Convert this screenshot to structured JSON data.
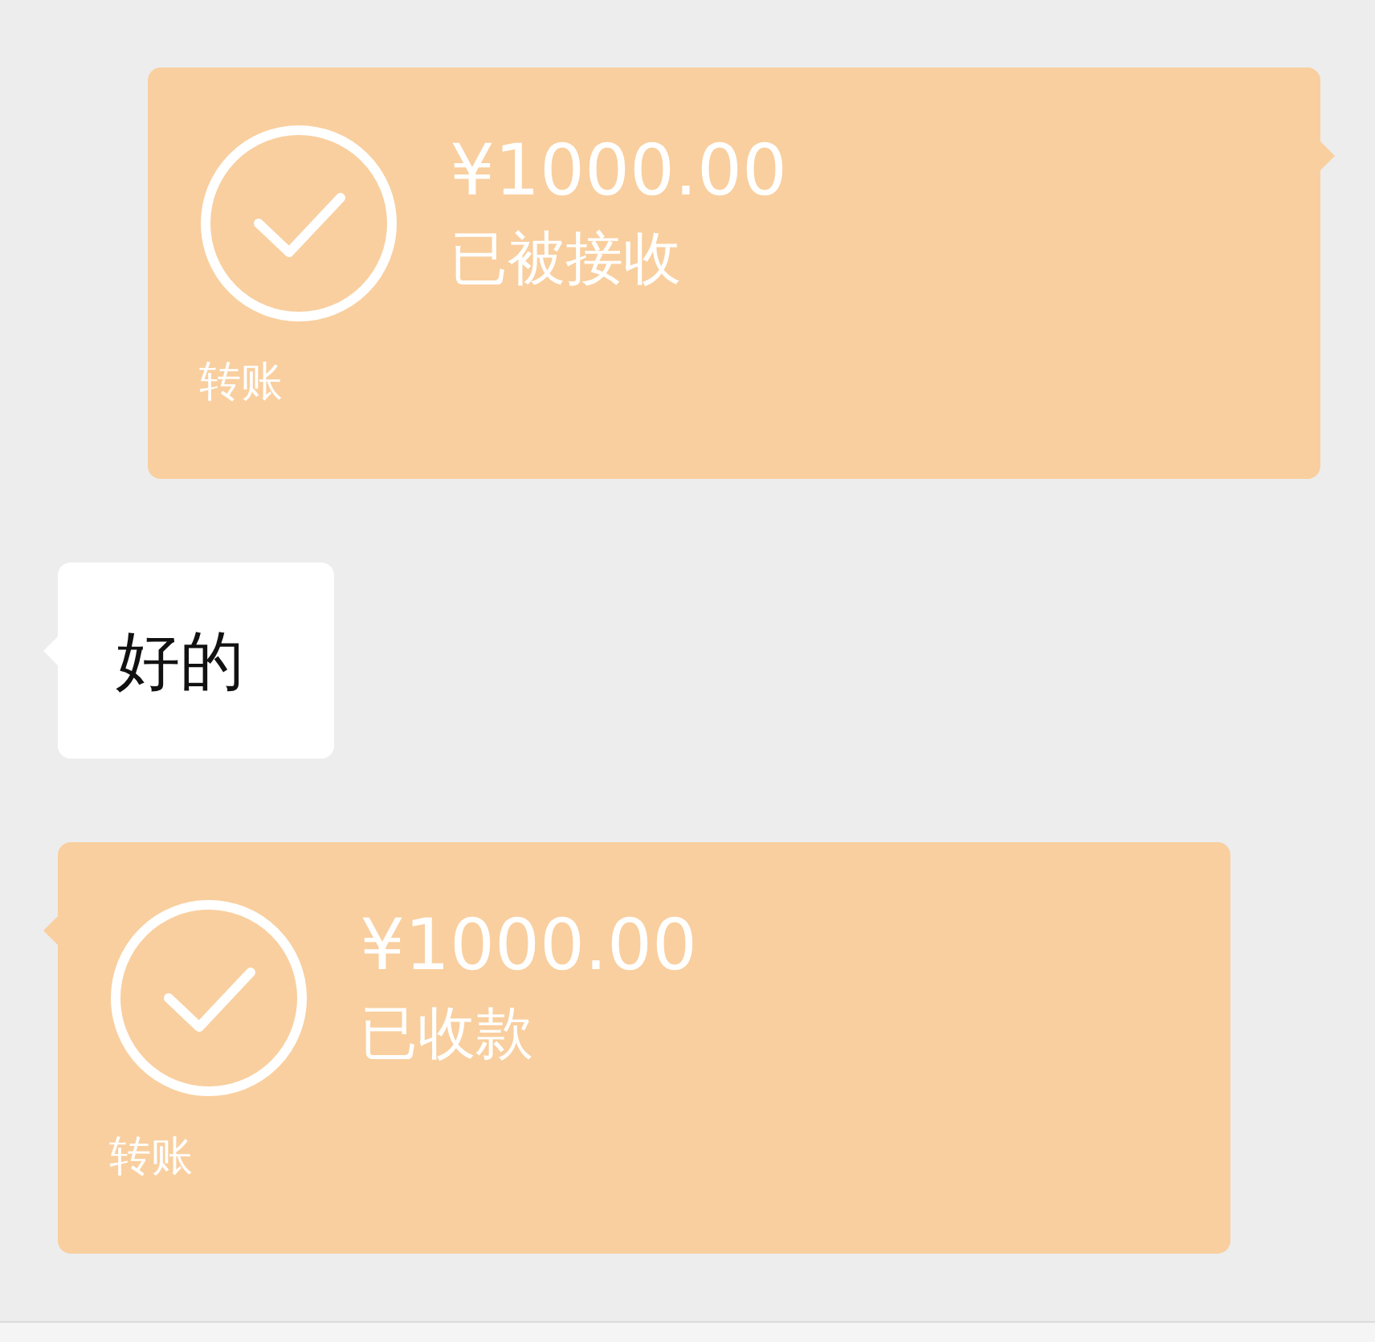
{
  "messages": [
    {
      "kind": "transfer",
      "outgoing": true,
      "amount": "¥1000.00",
      "status": "已被接收",
      "label": "转账"
    },
    {
      "kind": "text",
      "outgoing": false,
      "text": "好的"
    },
    {
      "kind": "transfer",
      "outgoing": false,
      "amount": "¥1000.00",
      "status": "已收款",
      "label": "转账"
    }
  ]
}
